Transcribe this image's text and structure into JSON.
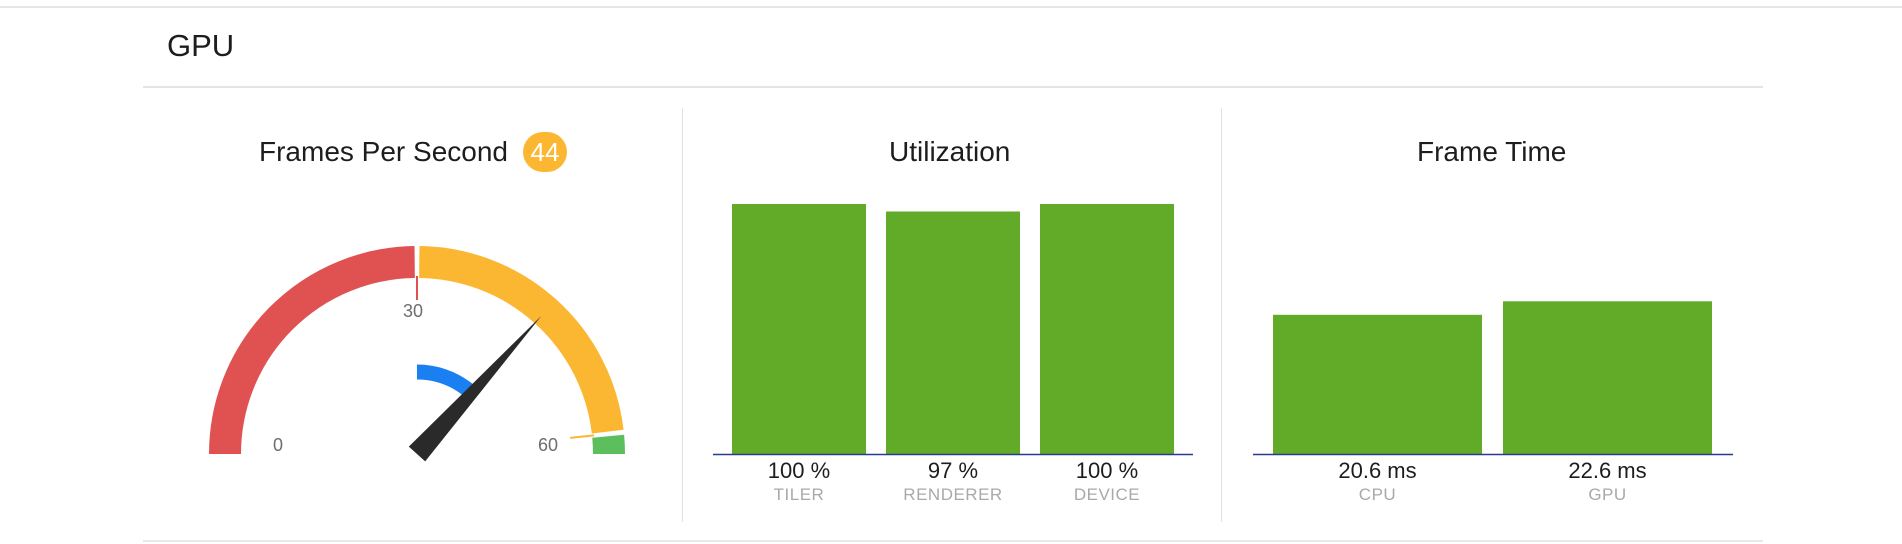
{
  "section": {
    "title": "GPU"
  },
  "panels": {
    "fps": {
      "title": "Frames Per Second",
      "badge": "44"
    },
    "utilization": {
      "title": "Utilization"
    },
    "frame_time": {
      "title": "Frame Time"
    }
  },
  "colors": {
    "bar": "#61ab28",
    "baseline": "#2b3a8c",
    "gauge_red": "#e05252",
    "gauge_yellow": "#fbb732",
    "gauge_green": "#5cbe5c",
    "gauge_blue": "#1a7ff0",
    "needle": "#2a2a2a",
    "badge": "#fbb732"
  },
  "chart_data": [
    {
      "type": "gauge",
      "title": "Frames Per Second",
      "value": 44,
      "secondary_value": 8,
      "range": [
        0,
        60
      ],
      "tick_labels": [
        "0",
        "30",
        "60"
      ],
      "bands": [
        {
          "from": 0,
          "to": 30,
          "color": "#e05252"
        },
        {
          "from": 30,
          "to": 58,
          "color": "#fbb732"
        },
        {
          "from": 58,
          "to": 60,
          "color": "#5cbe5c"
        }
      ]
    },
    {
      "type": "bar",
      "title": "Utilization",
      "categories": [
        "TILER",
        "RENDERER",
        "DEVICE"
      ],
      "values": [
        100,
        97,
        100
      ],
      "value_labels": [
        "100 %",
        "97 %",
        "100 %"
      ],
      "ylim": [
        0,
        100
      ]
    },
    {
      "type": "bar",
      "title": "Frame Time",
      "categories": [
        "CPU",
        "GPU"
      ],
      "values": [
        20.6,
        22.6
      ],
      "value_labels": [
        "20.6 ms",
        "22.6 ms"
      ],
      "ylim": [
        0,
        37
      ]
    }
  ]
}
